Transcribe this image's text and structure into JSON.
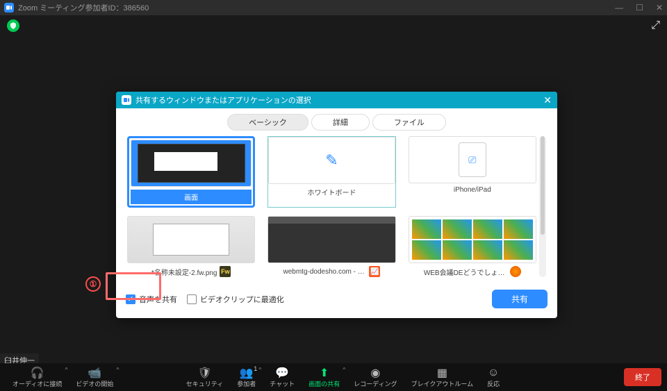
{
  "window": {
    "title": "Zoom ミーティング参加者ID：386560"
  },
  "modal": {
    "title": "共有するウィンドウまたはアプリケーションの選択",
    "tabs": {
      "basic": "ベーシック",
      "advanced": "詳細",
      "file": "ファイル"
    },
    "thumbs": {
      "screen": "画面",
      "whiteboard": "ホワイトボード",
      "iphone_ipad": "iPhone/iPad",
      "app1": "*名称未設定-2.fw.png",
      "app2": "webmtg-dodesho.com - Rank Tra…",
      "app3": "WEB会議DEどうでしょう | この一言…"
    },
    "footer": {
      "share_audio": "音声を共有",
      "optimize_video": "ビデオクリップに最適化",
      "share_btn": "共有"
    }
  },
  "annot": {
    "num": "①"
  },
  "participant": "臼井伸一",
  "toolbar": {
    "audio": "オーディオに接続",
    "video": "ビデオの開始",
    "security": "セキュリティ",
    "participants": "参加者",
    "participants_count": "1",
    "chat": "チャット",
    "share": "画面の共有",
    "record": "レコーディング",
    "breakout": "ブレイクアウトルーム",
    "reactions": "反応",
    "end": "終了"
  }
}
